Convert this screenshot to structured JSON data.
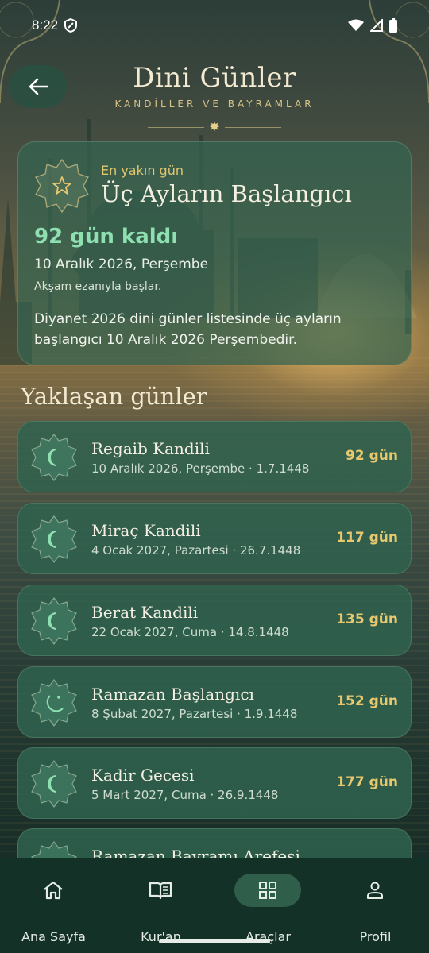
{
  "status_bar": {
    "time": "8:22"
  },
  "header": {
    "title": "Dini Günler",
    "subtitle": "KANDİLLER VE BAYRAMLAR"
  },
  "featured": {
    "kicker": "En yakın gün",
    "name": "Üç Ayların Başlangıcı",
    "countdown": "92 gün kaldı",
    "date": "10 Aralık 2026, Perşembe",
    "note": "Akşam ezanıyla başlar.",
    "description": "Diyanet 2026 dini günler listesinde üç ayların başlangıcı 10 Aralık 2026 Perşembedir.",
    "icon": "star-icon"
  },
  "upcoming": {
    "title": "Yaklaşan günler",
    "items": [
      {
        "name": "Regaib Kandili",
        "sub": "10 Aralık 2026, Perşembe · 1.7.1448",
        "days": "92 gün",
        "icon": "crescent-icon"
      },
      {
        "name": "Miraç Kandili",
        "sub": "4 Ocak 2027, Pazartesi · 26.7.1448",
        "days": "117 gün",
        "icon": "crescent-icon"
      },
      {
        "name": "Berat Kandili",
        "sub": "22 Ocak 2027, Cuma · 14.8.1448",
        "days": "135 gün",
        "icon": "crescent-icon"
      },
      {
        "name": "Ramazan Başlangıcı",
        "sub": "8 Şubat 2027, Pazartesi · 1.9.1448",
        "days": "152 gün",
        "icon": "moon-stars-icon"
      },
      {
        "name": "Kadir Gecesi",
        "sub": "5 Mart 2027, Cuma · 26.9.1448",
        "days": "177 gün",
        "icon": "crescent-icon"
      },
      {
        "name": "Ramazan Bayramı Arefesi",
        "sub": "",
        "days": "",
        "icon": "crescent-icon"
      }
    ]
  },
  "nav": {
    "items": [
      {
        "label": "Ana Sayfa",
        "icon": "home-icon"
      },
      {
        "label": "Kur'an",
        "icon": "book-icon"
      },
      {
        "label": "Araçlar",
        "icon": "grid-icon",
        "active": true
      },
      {
        "label": "Profil",
        "icon": "person-icon"
      }
    ]
  },
  "colors": {
    "accent_gold": "#e7c86e",
    "countdown_green": "#8ee0b0",
    "card_green": "#30624e",
    "nav_bg": "#143128"
  }
}
